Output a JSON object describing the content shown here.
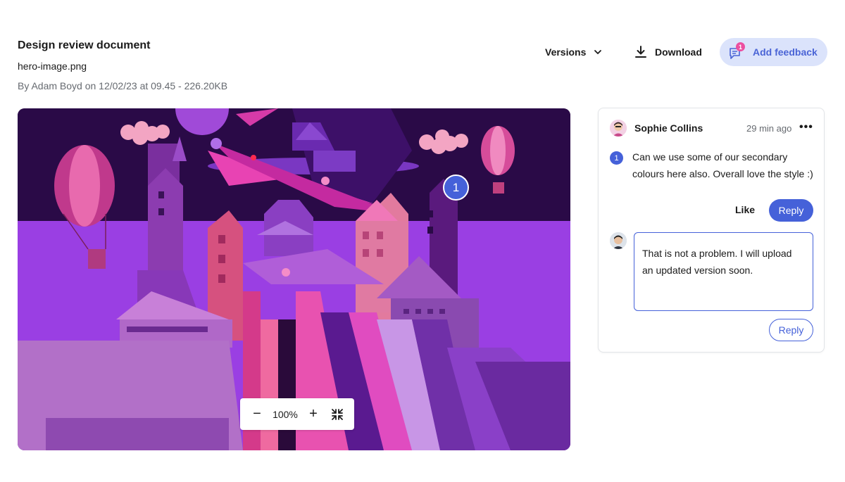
{
  "header": {
    "title": "Design review document",
    "file_name": "hero-image.png",
    "meta": "By Adam Boyd on 12/02/23 at 09.45 - 226.20KB"
  },
  "toolbar": {
    "versions_label": "Versions",
    "download_label": "Download",
    "add_feedback_label": "Add feedback",
    "feedback_count": "1"
  },
  "canvas": {
    "marker_number": "1",
    "zoom_level": "100%",
    "zoom_out": "−",
    "zoom_in": "+"
  },
  "comment": {
    "author": "Sophie Collins",
    "time": "29 min ago",
    "more": "•••",
    "number": "1",
    "text": "Can we use some of our secondary colours here also. Overall love the style :)",
    "like_label": "Like",
    "reply_label": "Reply"
  },
  "reply": {
    "text": "That is not a problem. I will upload an updated version soon.",
    "reply_label": "Reply"
  },
  "colors": {
    "accent": "#4561d9",
    "accent_light": "#dbe3fb",
    "badge": "#ec4fa0"
  }
}
